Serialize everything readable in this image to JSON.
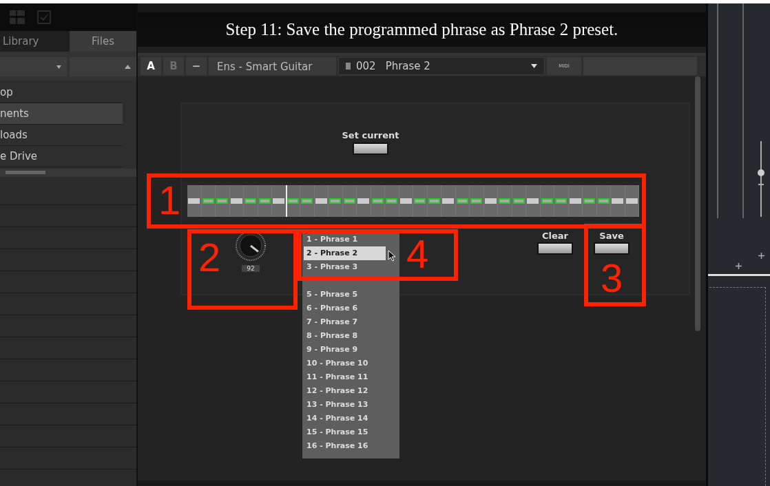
{
  "caption": "Step 11: Save the programmed phrase as Phrase 2 preset.",
  "sidebar": {
    "tabs": [
      {
        "label": "Library",
        "selected": false
      },
      {
        "label": "Files",
        "selected": true
      }
    ],
    "items": [
      {
        "label": "op",
        "selected": false
      },
      {
        "label": "nents",
        "selected": true
      },
      {
        "label": "loads",
        "selected": false
      },
      {
        "label": "e Drive",
        "selected": false
      }
    ]
  },
  "toolbar": {
    "buttons": [
      {
        "label": "A",
        "selected": true,
        "disabled": false
      },
      {
        "label": "B",
        "selected": false,
        "disabled": true
      },
      {
        "label": "−",
        "selected": false,
        "disabled": false
      }
    ],
    "instrument": "Ens - Smart Guitar",
    "preset_number": "002",
    "preset_name": "Phrase 2",
    "midi_label": "MIDI"
  },
  "panel": {
    "set_current_label": "Set current",
    "steps": [
      {
        "on": false,
        "playhead": false
      },
      {
        "on": true,
        "playhead": false
      },
      {
        "on": true,
        "playhead": false
      },
      {
        "on": false,
        "playhead": false
      },
      {
        "on": true,
        "playhead": false
      },
      {
        "on": true,
        "playhead": false
      },
      {
        "on": false,
        "playhead": false
      },
      {
        "on": true,
        "playhead": true
      },
      {
        "on": true,
        "playhead": false
      },
      {
        "on": false,
        "playhead": false
      },
      {
        "on": true,
        "playhead": false
      },
      {
        "on": true,
        "playhead": false
      },
      {
        "on": false,
        "playhead": false
      },
      {
        "on": true,
        "playhead": false
      },
      {
        "on": true,
        "playhead": false
      },
      {
        "on": false,
        "playhead": false
      },
      {
        "on": true,
        "playhead": false
      },
      {
        "on": true,
        "playhead": false
      },
      {
        "on": false,
        "playhead": false
      },
      {
        "on": true,
        "playhead": false
      },
      {
        "on": true,
        "playhead": false
      },
      {
        "on": false,
        "playhead": false
      },
      {
        "on": true,
        "playhead": false
      },
      {
        "on": true,
        "playhead": false
      },
      {
        "on": false,
        "playhead": false
      },
      {
        "on": true,
        "playhead": false
      },
      {
        "on": true,
        "playhead": false
      },
      {
        "on": false,
        "playhead": false
      },
      {
        "on": true,
        "playhead": false
      },
      {
        "on": true,
        "playhead": false
      },
      {
        "on": false,
        "playhead": false
      },
      {
        "on": false,
        "playhead": false
      }
    ],
    "knob": {
      "value": "92"
    },
    "clear_label": "Clear",
    "save_label": "Save",
    "phrases": [
      {
        "label": "1 - Phrase 1",
        "selected": false
      },
      {
        "label": "2 - Phrase 2",
        "selected": true
      },
      {
        "label": "3 - Phrase 3",
        "selected": false
      },
      {
        "label": "5 - Phrase 5",
        "selected": false
      },
      {
        "label": "6 - Phrase 6",
        "selected": false
      },
      {
        "label": "7 - Phrase 7",
        "selected": false
      },
      {
        "label": "8 - Phrase 8",
        "selected": false
      },
      {
        "label": "9 - Phrase 9",
        "selected": false
      },
      {
        "label": "10 - Phrase 10",
        "selected": false
      },
      {
        "label": "11 - Phrase 11",
        "selected": false
      },
      {
        "label": "12 - Phrase 12",
        "selected": false
      },
      {
        "label": "13 - Phrase 13",
        "selected": false
      },
      {
        "label": "14 - Phrase 14",
        "selected": false
      },
      {
        "label": "15 - Phrase 15",
        "selected": false
      },
      {
        "label": "16 - Phrase 16",
        "selected": false
      }
    ]
  },
  "right_panel": {
    "slider": {
      "level": 0.58
    }
  },
  "annotations": [
    {
      "label": "1"
    },
    {
      "label": "2"
    },
    {
      "label": "4"
    },
    {
      "label": "3"
    }
  ]
}
